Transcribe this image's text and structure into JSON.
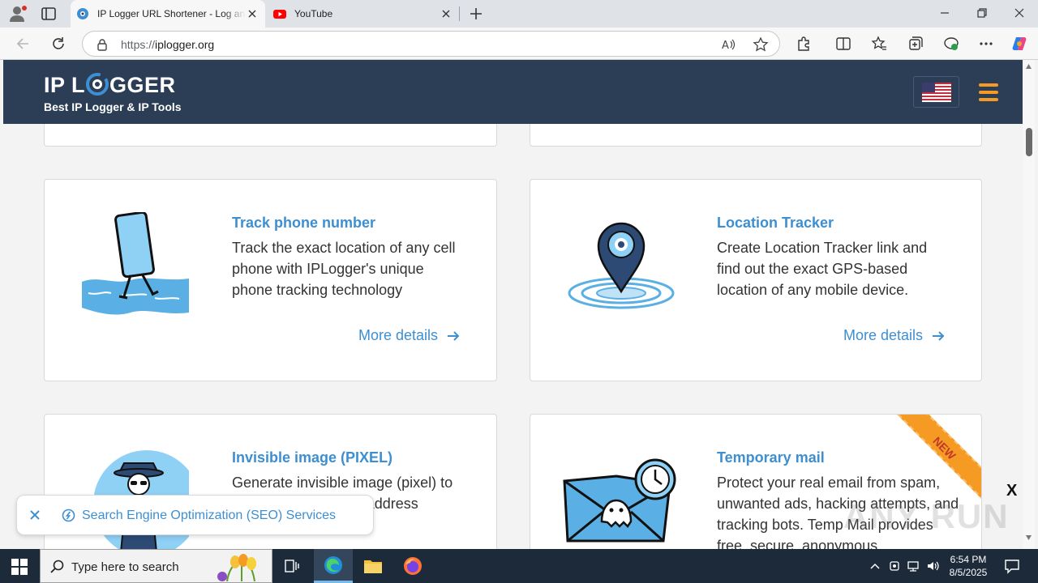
{
  "browser": {
    "tabs": [
      {
        "title": "IP Logger URL Shortener - Log and Track IP addresses",
        "active": true
      },
      {
        "title": "YouTube",
        "active": false
      }
    ],
    "address": {
      "scheme": "https://",
      "host": "iplogger.org"
    }
  },
  "site": {
    "logo_left": "IP L",
    "logo_right": "GGER",
    "tagline": "Best IP Logger & IP Tools",
    "accent": "#3d8fd1",
    "header_bg": "#2c3e56",
    "menu_color": "#f59a23"
  },
  "cards": [
    {
      "title": "Track phone number",
      "text": "Track the exact location of any cell phone with IPLogger's unique phone tracking technology",
      "more": "More details",
      "icon": "walking-phone-icon"
    },
    {
      "title": "Location Tracker",
      "text": "Create Location Tracker link and find out the exact GPS-based location of any mobile device.",
      "more": "More details",
      "icon": "map-pin-icon"
    },
    {
      "title": "Invisible image (PIXEL)",
      "text": "Generate invisible image (pixel) to website uses and IP address location",
      "icon": "spy-icon"
    },
    {
      "title": "Temporary mail",
      "text": "Protect your real email from spam, unwanted ads, hacking attempts, and tracking bots. Temp Mail provides free, secure, anonymous",
      "badge": "NEW",
      "icon": "ghost-mail-icon"
    }
  ],
  "banner": {
    "label": "Search Engine Optimization (SEO) Services"
  },
  "overlay": {
    "close": "X",
    "watermark": "ANY RUN"
  },
  "taskbar": {
    "search_placeholder": "Type here to search",
    "time": "6:54 PM",
    "date": "8/5/2025"
  }
}
